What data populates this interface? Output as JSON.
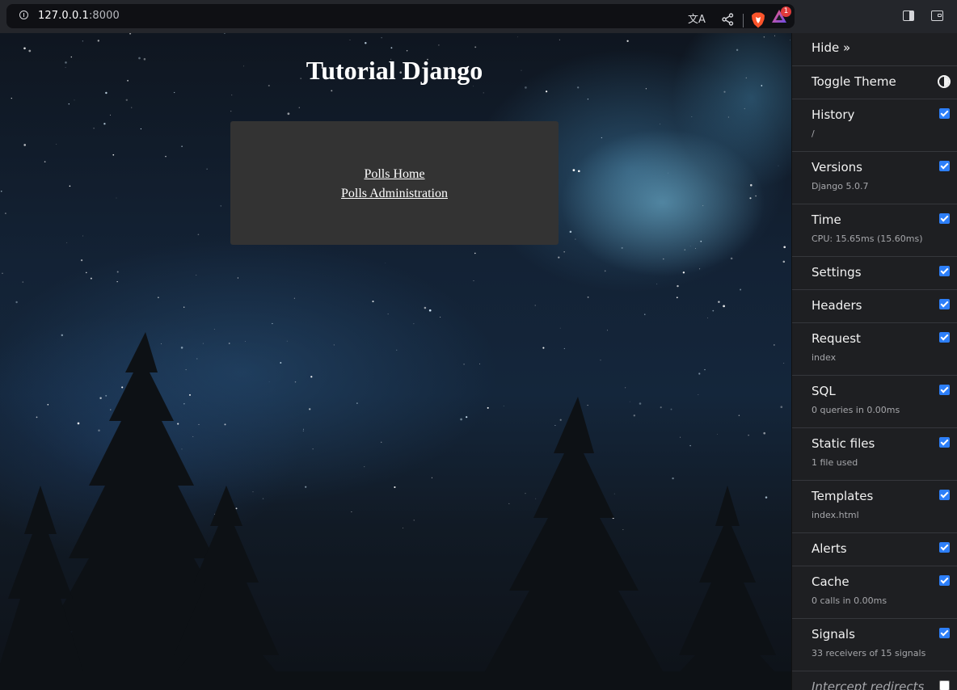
{
  "browser": {
    "url_host": "127.0.0.1",
    "url_port": ":8000",
    "rewards_badge": "1"
  },
  "page": {
    "title": "Tutorial Django",
    "links": [
      "Polls Home",
      "Polls Administration"
    ]
  },
  "toolbar": {
    "hide_label": "Hide »",
    "toggle_theme_label": "Toggle Theme",
    "panels": [
      {
        "title": "History",
        "subtitle": "/",
        "checked": true
      },
      {
        "title": "Versions",
        "subtitle": "Django 5.0.7",
        "checked": true
      },
      {
        "title": "Time",
        "subtitle": "CPU: 15.65ms (15.60ms)",
        "checked": true
      },
      {
        "title": "Settings",
        "subtitle": "",
        "checked": true
      },
      {
        "title": "Headers",
        "subtitle": "",
        "checked": true
      },
      {
        "title": "Request",
        "subtitle": "index",
        "checked": true
      },
      {
        "title": "SQL",
        "subtitle": "0 queries in 0.00ms",
        "checked": true
      },
      {
        "title": "Static files",
        "subtitle": "1 file used",
        "checked": true
      },
      {
        "title": "Templates",
        "subtitle": "index.html",
        "checked": true
      },
      {
        "title": "Alerts",
        "subtitle": "",
        "checked": true
      },
      {
        "title": "Cache",
        "subtitle": "0 calls in 0.00ms",
        "checked": true
      },
      {
        "title": "Signals",
        "subtitle": "33 receivers of 15 signals",
        "checked": true
      }
    ],
    "intercept_label": "Intercept redirects",
    "intercept_checked": false
  },
  "colors": {
    "accent_checkbox": "#2d7ff9",
    "toolbar_bg": "#1e1f22",
    "card_bg": "#333333"
  }
}
